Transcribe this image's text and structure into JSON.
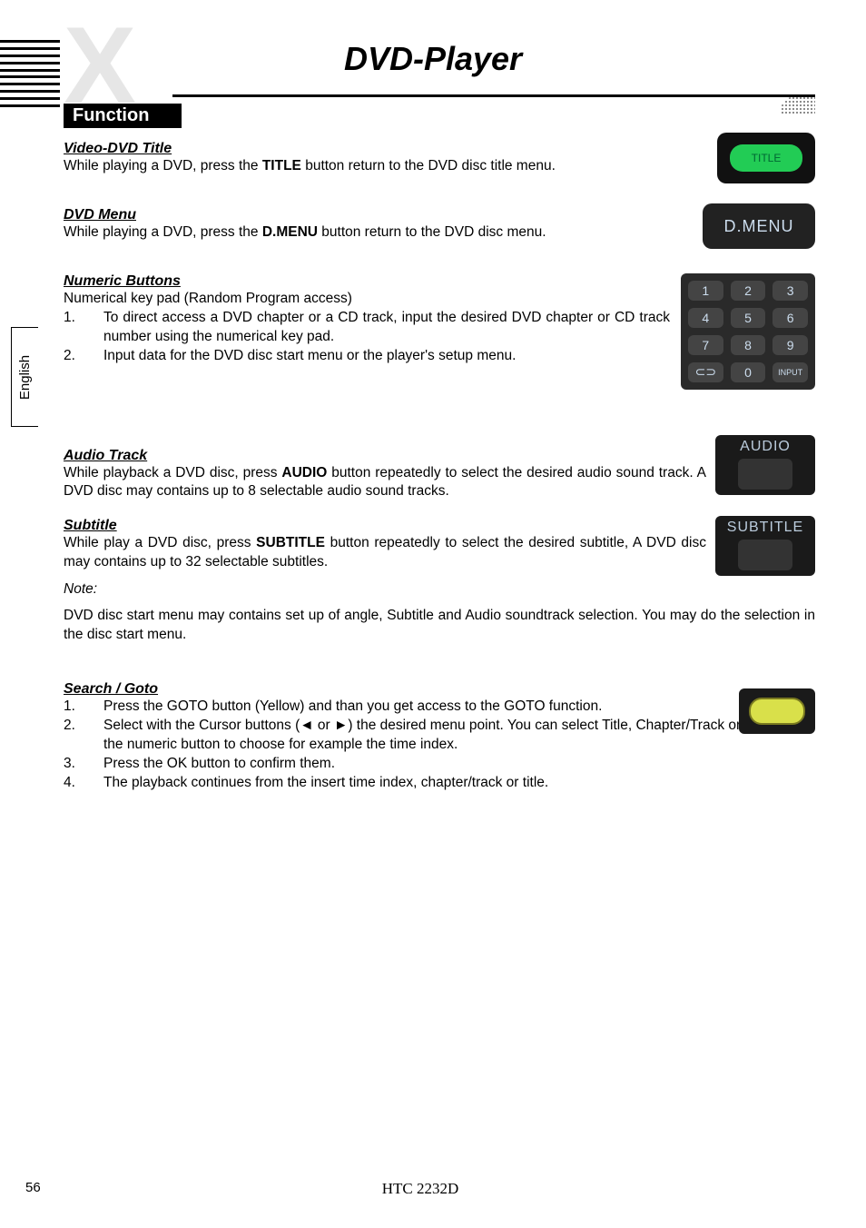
{
  "page_title": "DVD-Player",
  "language_tab": "English",
  "function_header": "Function",
  "sections": {
    "video_dvd_title": {
      "heading": "Video-DVD Title",
      "text_pre": "While playing a DVD, press the ",
      "bold": "TITLE",
      "text_post": " button return to the DVD disc title menu."
    },
    "dvd_menu": {
      "heading": "DVD Menu",
      "text_pre": "While playing a DVD, press the ",
      "bold": "D.MENU",
      "text_post": " button return to the DVD disc menu."
    },
    "numeric": {
      "heading": "Numeric Buttons",
      "intro": "Numerical key pad (Random Program access)",
      "items": [
        "To direct access a DVD chapter or a CD track, input the desired DVD chapter or CD track number using the numerical key pad.",
        "Input data for the DVD disc start menu or the player's setup menu."
      ]
    },
    "audio": {
      "heading": "Audio Track",
      "text_pre": "While playback a DVD disc, press ",
      "bold": "AUDIO",
      "text_post": " button repeatedly to select the desired audio sound track. A DVD disc may contains up to 8 selectable audio sound tracks."
    },
    "subtitle": {
      "heading": "Subtitle",
      "text_pre": "While play a DVD disc, press ",
      "bold": "SUBTITLE",
      "text_post": " button repeatedly to select the desired subtitle, A DVD disc may contains up to 32 selectable subtitles."
    },
    "note_label": "Note:",
    "note_text": "DVD disc start menu may contains set up of angle, Subtitle and Audio soundtrack selection. You may do the selection in the disc start menu.",
    "search": {
      "heading": "Search / Goto",
      "items": [
        "Press the GOTO button (Yellow) and than you get access to the GOTO function.",
        "Select with the Cursor buttons (◄ or ►) the desired menu point. You can select Title, Chapter/Track or Time. Uses the numeric button to choose for example the time index.",
        "Press the OK button to confirm them.",
        "The playback continues from the insert time index, chapter/track or title."
      ]
    }
  },
  "remote": {
    "title_label": "TITLE",
    "dmenu_label": "D.MENU",
    "audio_label": "AUDIO",
    "subtitle_label": "SUBTITLE",
    "keypad": [
      "1",
      "2",
      "3",
      "4",
      "5",
      "6",
      "7",
      "8",
      "9",
      "⊂⊃",
      "0",
      "INPUT"
    ]
  },
  "footer": {
    "page": "56",
    "model": "HTC 2232D"
  }
}
